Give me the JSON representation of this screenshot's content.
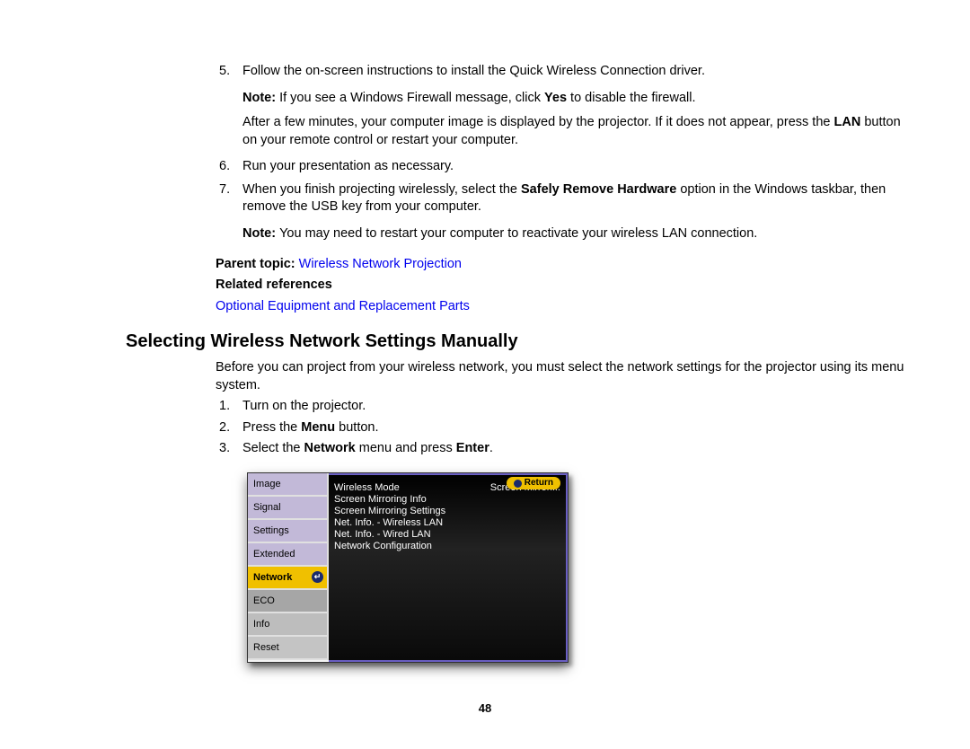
{
  "steps_top": [
    {
      "num": "5.",
      "text": "Follow the on-screen instructions to install the Quick Wireless Connection driver."
    }
  ],
  "note1_prefix": "Note: ",
  "note1_a": "If you see a Windows Firewall message, click ",
  "note1_bold": "Yes",
  "note1_b": " to disable the firewall.",
  "after1_a": "After a few minutes, your computer image is displayed by the projector. If it does not appear, press the ",
  "after1_bold": "LAN",
  "after1_b": " button on your remote control or restart your computer.",
  "steps_mid": [
    {
      "num": "6.",
      "text": "Run your presentation as necessary."
    }
  ],
  "step7_num": "7.",
  "step7_a": "When you finish projecting wirelessly, select the ",
  "step7_bold": "Safely Remove Hardware",
  "step7_b": " option in the Windows taskbar, then remove the USB key from your computer.",
  "note2_prefix": "Note: ",
  "note2_text": "You may need to restart your computer to reactivate your wireless LAN connection.",
  "parent_label": "Parent topic: ",
  "parent_link": "Wireless Network Projection",
  "related_label": "Related references",
  "related_link": "Optional Equipment and Replacement Parts",
  "heading": "Selecting Wireless Network Settings Manually",
  "intro": "Before you can project from your wireless network, you must select the network settings for the projector using its menu system.",
  "steps2": {
    "s1_num": "1.",
    "s1_text": "Turn on the projector.",
    "s2_num": "2.",
    "s2_a": "Press the ",
    "s2_bold": "Menu",
    "s2_b": " button.",
    "s3_num": "3.",
    "s3_a": "Select the ",
    "s3_bold1": "Network",
    "s3_mid": " menu and press ",
    "s3_bold2": "Enter",
    "s3_end": "."
  },
  "menu": {
    "left": [
      "Image",
      "Signal",
      "Settings",
      "Extended",
      "Network",
      "ECO",
      "Info",
      "Reset"
    ],
    "return": "Return",
    "row_key": "Wireless Mode",
    "row_val": "Screen Mirrori...",
    "items": [
      "Screen Mirroring Info",
      "Screen Mirroring Settings",
      "Net. Info. - Wireless LAN",
      "Net. Info. - Wired LAN",
      "Network Configuration"
    ]
  },
  "pagenum": "48"
}
